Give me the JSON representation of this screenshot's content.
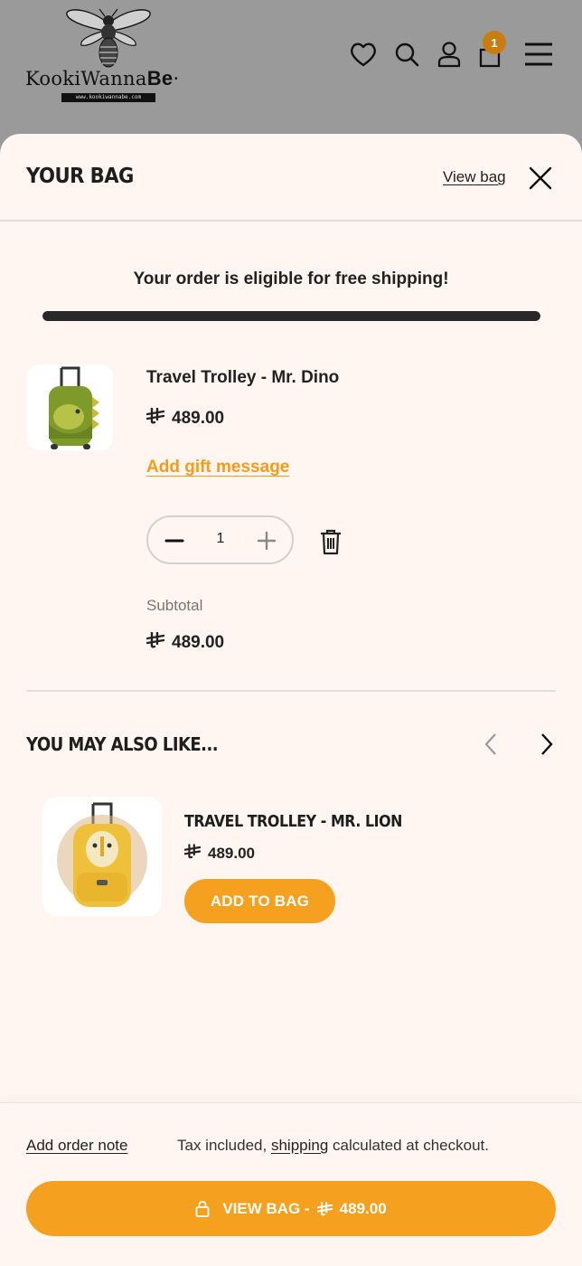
{
  "header": {
    "logo_text_light": "KookiWanna",
    "logo_text_bold": "Be",
    "logo_url": "www.kookiwannabe.com",
    "cart_count": "1"
  },
  "drawer": {
    "title": "YOUR BAG",
    "view_bag_label": "View bag"
  },
  "shipping": {
    "message": "Your order is eligible for free shipping!",
    "progress": 1.0
  },
  "cart_item": {
    "title": "Travel Trolley - Mr. Dino",
    "price": "489.00",
    "gift_link": "Add gift message",
    "quantity": "1",
    "subtotal_label": "Subtotal",
    "subtotal_value": "489.00"
  },
  "recommendations": {
    "title": "YOU MAY ALSO LIKE...",
    "items": [
      {
        "title": "TRAVEL TROLLEY - MR. LION",
        "price": "489.00",
        "button_label": "ADD TO BAG"
      }
    ]
  },
  "footer": {
    "note_link": "Add order note",
    "tax_prefix": "Tax included,",
    "shipping_link": "shipping",
    "tax_suffix": "calculated at checkout.",
    "checkout_prefix": "VIEW BAG -",
    "checkout_total": "489.00"
  },
  "colors": {
    "accent": "#f6a020",
    "drawer_bg": "#fff5f1",
    "header_bg": "#9a9a9a",
    "progress_fill": "#2a2828"
  },
  "icons": [
    "heart-icon",
    "search-icon",
    "user-icon",
    "cart-icon",
    "menu-icon",
    "close-icon",
    "minus-icon",
    "plus-icon",
    "trash-icon",
    "chevron-left-icon",
    "chevron-right-icon",
    "lock-icon",
    "riyal-currency-icon"
  ]
}
